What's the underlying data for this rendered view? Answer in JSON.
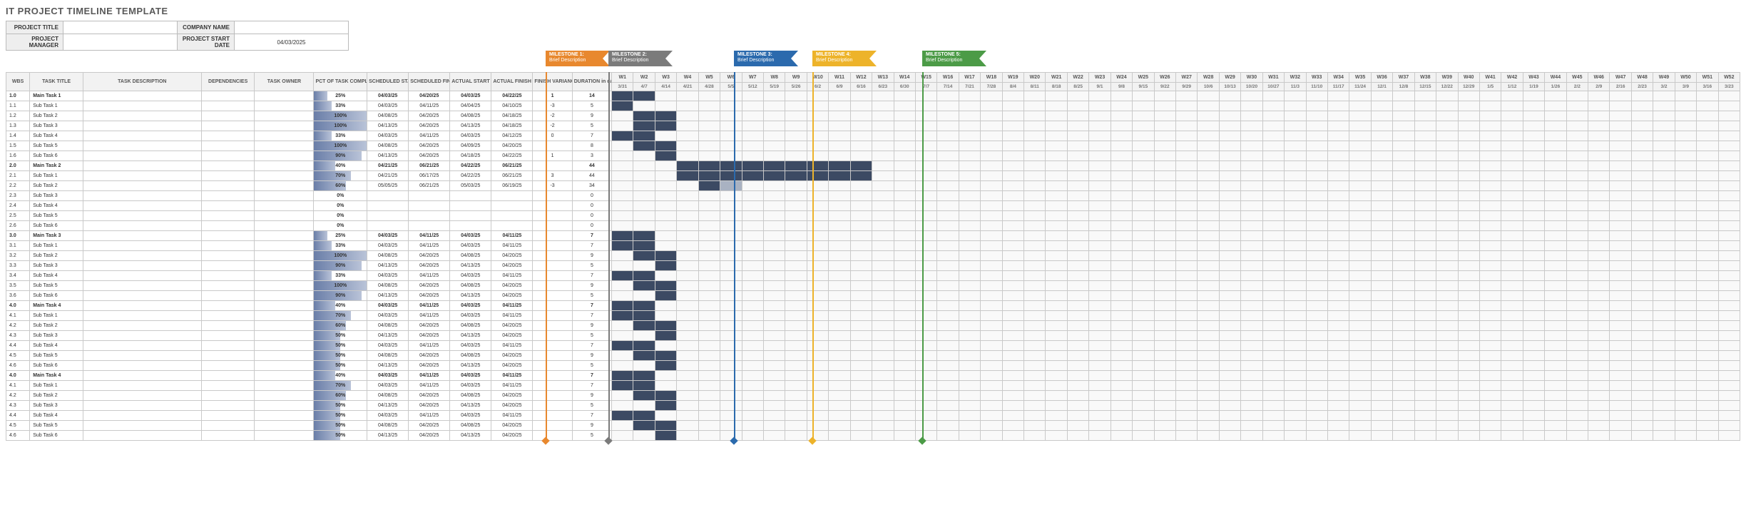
{
  "title": "IT PROJECT TIMELINE TEMPLATE",
  "info": {
    "projectTitleLabel": "PROJECT TITLE",
    "projectTitle": "",
    "companyNameLabel": "COMPANY NAME",
    "companyName": "",
    "projectManagerLabel": "PROJECT MANAGER",
    "projectManager": "",
    "projectStartDateLabel": "PROJECT START DATE",
    "projectStartDate": "04/03/2025"
  },
  "milestones": [
    {
      "name": "MILESTONE 1:",
      "desc": "Brief Description",
      "cls": "ms-orange",
      "week": 7
    },
    {
      "name": "MILESTONE 2:",
      "desc": "Brief Description",
      "cls": "ms-gray",
      "week": 11
    },
    {
      "name": "MILESTONE 3:",
      "desc": "Brief Description",
      "cls": "ms-blue",
      "week": 19
    },
    {
      "name": "MILESTONE 4:",
      "desc": "Brief Description",
      "cls": "ms-yellow",
      "week": 24
    },
    {
      "name": "MILESTONE 5:",
      "desc": "Brief Description",
      "cls": "ms-green",
      "week": 31
    }
  ],
  "headers": {
    "wbs": "WBS",
    "taskTitle": "TASK TITLE",
    "taskDesc": "TASK DESCRIPTION",
    "dep": "DEPENDENCIES",
    "owner": "TASK OWNER",
    "pct": "PCT OF TASK COMPLETE",
    "schStart": "SCHEDULED START",
    "schFinish": "SCHEDULED FINISH",
    "actStart": "ACTUAL START",
    "actFinish": "ACTUAL FINISH",
    "finVar": "FINISH VARIANCE",
    "dur": "DURATION in days"
  },
  "weeks": [
    {
      "w": "W1",
      "d": "3/31"
    },
    {
      "w": "W2",
      "d": "4/7"
    },
    {
      "w": "W3",
      "d": "4/14"
    },
    {
      "w": "W4",
      "d": "4/21"
    },
    {
      "w": "W5",
      "d": "4/28"
    },
    {
      "w": "W6",
      "d": "5/5"
    },
    {
      "w": "W7",
      "d": "5/12"
    },
    {
      "w": "W8",
      "d": "5/19"
    },
    {
      "w": "W9",
      "d": "5/26"
    },
    {
      "w": "W10",
      "d": "6/2"
    },
    {
      "w": "W11",
      "d": "6/9"
    },
    {
      "w": "W12",
      "d": "6/16"
    },
    {
      "w": "W13",
      "d": "6/23"
    },
    {
      "w": "W14",
      "d": "6/30"
    },
    {
      "w": "W15",
      "d": "7/7"
    },
    {
      "w": "W16",
      "d": "7/14"
    },
    {
      "w": "W17",
      "d": "7/21"
    },
    {
      "w": "W18",
      "d": "7/28"
    },
    {
      "w": "W19",
      "d": "8/4"
    },
    {
      "w": "W20",
      "d": "8/11"
    },
    {
      "w": "W21",
      "d": "8/18"
    },
    {
      "w": "W22",
      "d": "8/25"
    },
    {
      "w": "W23",
      "d": "9/1"
    },
    {
      "w": "W24",
      "d": "9/8"
    },
    {
      "w": "W25",
      "d": "9/15"
    },
    {
      "w": "W26",
      "d": "9/22"
    },
    {
      "w": "W27",
      "d": "9/29"
    },
    {
      "w": "W28",
      "d": "10/6"
    },
    {
      "w": "W29",
      "d": "10/13"
    },
    {
      "w": "W30",
      "d": "10/20"
    },
    {
      "w": "W31",
      "d": "10/27"
    },
    {
      "w": "W32",
      "d": "11/3"
    },
    {
      "w": "W33",
      "d": "11/10"
    },
    {
      "w": "W34",
      "d": "11/17"
    },
    {
      "w": "W35",
      "d": "11/24"
    },
    {
      "w": "W36",
      "d": "12/1"
    },
    {
      "w": "W37",
      "d": "12/8"
    },
    {
      "w": "W38",
      "d": "12/15"
    },
    {
      "w": "W39",
      "d": "12/22"
    },
    {
      "w": "W40",
      "d": "12/29"
    },
    {
      "w": "W41",
      "d": "1/5"
    },
    {
      "w": "W42",
      "d": "1/12"
    },
    {
      "w": "W43",
      "d": "1/19"
    },
    {
      "w": "W44",
      "d": "1/26"
    },
    {
      "w": "W45",
      "d": "2/2"
    },
    {
      "w": "W46",
      "d": "2/9"
    },
    {
      "w": "W47",
      "d": "2/16"
    },
    {
      "w": "W48",
      "d": "2/23"
    },
    {
      "w": "W49",
      "d": "3/2"
    },
    {
      "w": "W50",
      "d": "3/9"
    },
    {
      "w": "W51",
      "d": "3/16"
    },
    {
      "w": "W52",
      "d": "3/23"
    }
  ],
  "rows": [
    {
      "wbs": "1.0",
      "title": "Main Task 1",
      "bold": true,
      "pct": 25,
      "ss": "04/03/25",
      "sf": "04/20/25",
      "as": "04/03/25",
      "af": "04/22/25",
      "fv": "1",
      "dur": "14",
      "bars": [
        1,
        2
      ]
    },
    {
      "wbs": "1.1",
      "title": "Sub Task 1",
      "pct": 33,
      "ss": "04/03/25",
      "sf": "04/11/25",
      "as": "04/04/25",
      "af": "04/10/25",
      "fv": "-3",
      "dur": "5",
      "bars": [
        1
      ]
    },
    {
      "wbs": "1.2",
      "title": "Sub Task 2",
      "pct": 100,
      "ss": "04/08/25",
      "sf": "04/20/25",
      "as": "04/08/25",
      "af": "04/18/25",
      "fv": "-2",
      "dur": "9",
      "bars": [
        2,
        3
      ]
    },
    {
      "wbs": "1.3",
      "title": "Sub Task 3",
      "pct": 100,
      "ss": "04/13/25",
      "sf": "04/20/25",
      "as": "04/13/25",
      "af": "04/18/25",
      "fv": "-2",
      "dur": "5",
      "bars": [
        2,
        3
      ]
    },
    {
      "wbs": "1.4",
      "title": "Sub Task 4",
      "pct": 33,
      "ss": "04/03/25",
      "sf": "04/11/25",
      "as": "04/03/25",
      "af": "04/12/25",
      "fv": "0",
      "dur": "7",
      "bars": [
        1,
        2
      ]
    },
    {
      "wbs": "1.5",
      "title": "Sub Task 5",
      "pct": 100,
      "ss": "04/08/25",
      "sf": "04/20/25",
      "as": "04/09/25",
      "af": "04/20/25",
      "fv": "",
      "dur": "8",
      "bars": [
        2,
        3
      ]
    },
    {
      "wbs": "1.6",
      "title": "Sub Task 6",
      "pct": 90,
      "ss": "04/13/25",
      "sf": "04/20/25",
      "as": "04/18/25",
      "af": "04/22/25",
      "fv": "1",
      "dur": "3",
      "bars": [
        3
      ]
    },
    {
      "wbs": "2.0",
      "title": "Main Task 2",
      "bold": true,
      "pct": 40,
      "ss": "04/21/25",
      "sf": "06/21/25",
      "as": "04/22/25",
      "af": "06/21/25",
      "fv": "",
      "dur": "44",
      "bars": [
        4,
        5,
        6,
        7,
        8,
        9,
        10,
        11,
        12
      ]
    },
    {
      "wbs": "2.1",
      "title": "Sub Task 1",
      "pct": 70,
      "ss": "04/21/25",
      "sf": "06/17/25",
      "as": "04/22/25",
      "af": "06/21/25",
      "fv": "3",
      "dur": "44",
      "bars": [
        4,
        5,
        6,
        7,
        8,
        9,
        10,
        11,
        12
      ]
    },
    {
      "wbs": "2.2",
      "title": "Sub Task 2",
      "pct": 60,
      "ss": "05/05/25",
      "sf": "06/21/25",
      "as": "05/03/25",
      "af": "06/19/25",
      "fv": "-3",
      "dur": "34",
      "bars": [
        5
      ],
      "light": [
        6
      ]
    },
    {
      "wbs": "2.3",
      "title": "Sub Task 3",
      "pct": 0,
      "ss": "",
      "sf": "",
      "as": "",
      "af": "",
      "fv": "",
      "dur": "0",
      "bars": []
    },
    {
      "wbs": "2.4",
      "title": "Sub Task 4",
      "pct": 0,
      "ss": "",
      "sf": "",
      "as": "",
      "af": "",
      "fv": "",
      "dur": "0",
      "bars": []
    },
    {
      "wbs": "2.5",
      "title": "Sub Task 5",
      "pct": 0,
      "ss": "",
      "sf": "",
      "as": "",
      "af": "",
      "fv": "",
      "dur": "0",
      "bars": []
    },
    {
      "wbs": "2.6",
      "title": "Sub Task 6",
      "pct": 0,
      "ss": "",
      "sf": "",
      "as": "",
      "af": "",
      "fv": "",
      "dur": "0",
      "bars": []
    },
    {
      "wbs": "3.0",
      "title": "Main Task 3",
      "bold": true,
      "pct": 25,
      "ss": "04/03/25",
      "sf": "04/11/25",
      "as": "04/03/25",
      "af": "04/11/25",
      "fv": "",
      "dur": "7",
      "bars": [
        1,
        2
      ]
    },
    {
      "wbs": "3.1",
      "title": "Sub Task 1",
      "pct": 33,
      "ss": "04/03/25",
      "sf": "04/11/25",
      "as": "04/03/25",
      "af": "04/11/25",
      "fv": "",
      "dur": "7",
      "bars": [
        1,
        2
      ]
    },
    {
      "wbs": "3.2",
      "title": "Sub Task 2",
      "pct": 100,
      "ss": "04/08/25",
      "sf": "04/20/25",
      "as": "04/08/25",
      "af": "04/20/25",
      "fv": "",
      "dur": "9",
      "bars": [
        2,
        3
      ]
    },
    {
      "wbs": "3.3",
      "title": "Sub Task 3",
      "pct": 90,
      "ss": "04/13/25",
      "sf": "04/20/25",
      "as": "04/13/25",
      "af": "04/20/25",
      "fv": "",
      "dur": "5",
      "bars": [
        3
      ]
    },
    {
      "wbs": "3.4",
      "title": "Sub Task 4",
      "pct": 33,
      "ss": "04/03/25",
      "sf": "04/11/25",
      "as": "04/03/25",
      "af": "04/11/25",
      "fv": "",
      "dur": "7",
      "bars": [
        1,
        2
      ]
    },
    {
      "wbs": "3.5",
      "title": "Sub Task 5",
      "pct": 100,
      "ss": "04/08/25",
      "sf": "04/20/25",
      "as": "04/08/25",
      "af": "04/20/25",
      "fv": "",
      "dur": "9",
      "bars": [
        2,
        3
      ]
    },
    {
      "wbs": "3.6",
      "title": "Sub Task 6",
      "pct": 90,
      "ss": "04/13/25",
      "sf": "04/20/25",
      "as": "04/13/25",
      "af": "04/20/25",
      "fv": "",
      "dur": "5",
      "bars": [
        3
      ]
    },
    {
      "wbs": "4.0",
      "title": "Main Task 4",
      "bold": true,
      "pct": 40,
      "ss": "04/03/25",
      "sf": "04/11/25",
      "as": "04/03/25",
      "af": "04/11/25",
      "fv": "",
      "dur": "7",
      "bars": [
        1,
        2
      ]
    },
    {
      "wbs": "4.1",
      "title": "Sub Task 1",
      "pct": 70,
      "ss": "04/03/25",
      "sf": "04/11/25",
      "as": "04/03/25",
      "af": "04/11/25",
      "fv": "",
      "dur": "7",
      "bars": [
        1,
        2
      ]
    },
    {
      "wbs": "4.2",
      "title": "Sub Task 2",
      "pct": 60,
      "ss": "04/08/25",
      "sf": "04/20/25",
      "as": "04/08/25",
      "af": "04/20/25",
      "fv": "",
      "dur": "9",
      "bars": [
        2,
        3
      ]
    },
    {
      "wbs": "4.3",
      "title": "Sub Task 3",
      "pct": 50,
      "ss": "04/13/25",
      "sf": "04/20/25",
      "as": "04/13/25",
      "af": "04/20/25",
      "fv": "",
      "dur": "5",
      "bars": [
        3
      ]
    },
    {
      "wbs": "4.4",
      "title": "Sub Task 4",
      "pct": 50,
      "ss": "04/03/25",
      "sf": "04/11/25",
      "as": "04/03/25",
      "af": "04/11/25",
      "fv": "",
      "dur": "7",
      "bars": [
        1,
        2
      ]
    },
    {
      "wbs": "4.5",
      "title": "Sub Task 5",
      "pct": 50,
      "ss": "04/08/25",
      "sf": "04/20/25",
      "as": "04/08/25",
      "af": "04/20/25",
      "fv": "",
      "dur": "9",
      "bars": [
        2,
        3
      ]
    },
    {
      "wbs": "4.6",
      "title": "Sub Task 6",
      "pct": 50,
      "ss": "04/13/25",
      "sf": "04/20/25",
      "as": "04/13/25",
      "af": "04/20/25",
      "fv": "",
      "dur": "5",
      "bars": [
        3
      ]
    },
    {
      "wbs": "4.0",
      "title": "Main Task 4",
      "bold": true,
      "pct": 40,
      "ss": "04/03/25",
      "sf": "04/11/25",
      "as": "04/03/25",
      "af": "04/11/25",
      "fv": "",
      "dur": "7",
      "bars": [
        1,
        2
      ]
    },
    {
      "wbs": "4.1",
      "title": "Sub Task 1",
      "pct": 70,
      "ss": "04/03/25",
      "sf": "04/11/25",
      "as": "04/03/25",
      "af": "04/11/25",
      "fv": "",
      "dur": "7",
      "bars": [
        1,
        2
      ]
    },
    {
      "wbs": "4.2",
      "title": "Sub Task 2",
      "pct": 60,
      "ss": "04/08/25",
      "sf": "04/20/25",
      "as": "04/08/25",
      "af": "04/20/25",
      "fv": "",
      "dur": "9",
      "bars": [
        2,
        3
      ]
    },
    {
      "wbs": "4.3",
      "title": "Sub Task 3",
      "pct": 50,
      "ss": "04/13/25",
      "sf": "04/20/25",
      "as": "04/13/25",
      "af": "04/20/25",
      "fv": "",
      "dur": "5",
      "bars": [
        3
      ]
    },
    {
      "wbs": "4.4",
      "title": "Sub Task 4",
      "pct": 50,
      "ss": "04/03/25",
      "sf": "04/11/25",
      "as": "04/03/25",
      "af": "04/11/25",
      "fv": "",
      "dur": "7",
      "bars": [
        1,
        2
      ]
    },
    {
      "wbs": "4.5",
      "title": "Sub Task 5",
      "pct": 50,
      "ss": "04/08/25",
      "sf": "04/20/25",
      "as": "04/08/25",
      "af": "04/20/25",
      "fv": "",
      "dur": "9",
      "bars": [
        2,
        3
      ]
    },
    {
      "wbs": "4.6",
      "title": "Sub Task 6",
      "pct": 50,
      "ss": "04/13/25",
      "sf": "04/20/25",
      "as": "04/13/25",
      "af": "04/20/25",
      "fv": "",
      "dur": "5",
      "bars": [
        3
      ]
    }
  ]
}
